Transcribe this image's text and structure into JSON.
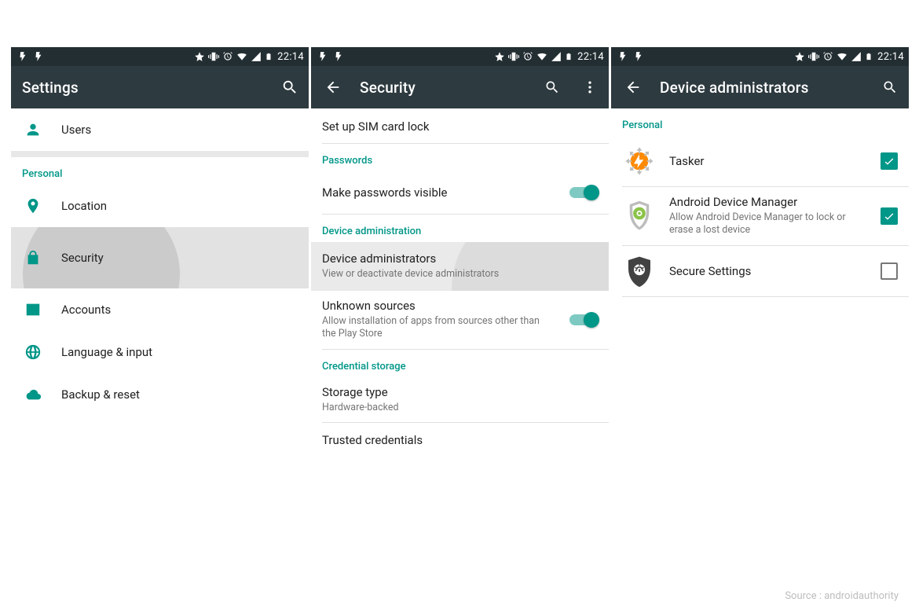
{
  "status_time": "22:14",
  "source_credit": "Source : androidauthority",
  "screen1": {
    "title": "Settings",
    "users_label": "Users",
    "section": "Personal",
    "items": {
      "location": "Location",
      "security": "Security",
      "accounts": "Accounts",
      "language": "Language & input",
      "backup": "Backup & reset"
    }
  },
  "screen2": {
    "title": "Security",
    "sim_lock": "Set up SIM card lock",
    "pw_section": "Passwords",
    "pw_visible": "Make passwords visible",
    "da_section": "Device administration",
    "da_title": "Device administrators",
    "da_sub": "View or deactivate device administrators",
    "unknown_title": "Unknown sources",
    "unknown_sub": "Allow installation of apps from sources other than the Play Store",
    "cred_section": "Credential storage",
    "storage_title": "Storage type",
    "storage_sub": "Hardware-backed",
    "trusted": "Trusted credentials"
  },
  "screen3": {
    "title": "Device administrators",
    "section": "Personal",
    "items": [
      {
        "name": "Tasker",
        "sub": "",
        "checked": true
      },
      {
        "name": "Android Device Manager",
        "sub": "Allow Android Device Manager to lock or erase a lost device",
        "checked": true
      },
      {
        "name": "Secure Settings",
        "sub": "",
        "checked": false
      }
    ]
  }
}
